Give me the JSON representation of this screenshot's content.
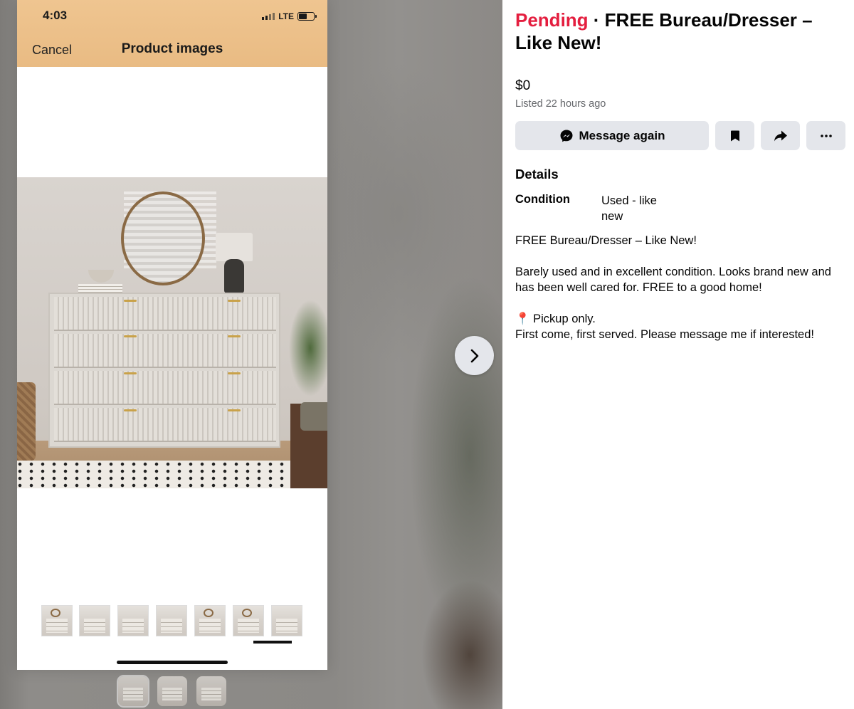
{
  "phone": {
    "time": "4:03",
    "network": "LTE",
    "cancel_label": "Cancel",
    "title": "Product images"
  },
  "listing": {
    "status": "Pending",
    "separator": " · ",
    "title": "FREE Bureau/Dresser – Like New!",
    "price": "$0",
    "listed": "Listed 22 hours ago",
    "status_color": "#e41e3f"
  },
  "actions": {
    "message_label": "Message again",
    "message_icon": "messenger-icon",
    "save_icon": "bookmark-icon",
    "share_icon": "share-arrow-icon",
    "more_icon": "more-dots-icon"
  },
  "details": {
    "heading": "Details",
    "condition_label": "Condition",
    "condition_value": "Used - like new",
    "description": {
      "line1": "FREE Bureau/Dresser – Like New!",
      "line2": "Barely used and in excellent condition. Looks brand new and has been well cared for. FREE to a good home!",
      "pin": "📍",
      "line3": " Pickup only.",
      "line4": "First come, first served. Please message me if interested!"
    }
  },
  "viewer": {
    "next_icon": "chevron-right-icon",
    "phone_thumbnail_count": 7,
    "active_phone_thumbnail": 6,
    "gallery_thumbnail_count": 3,
    "active_gallery_thumbnail": 1
  }
}
